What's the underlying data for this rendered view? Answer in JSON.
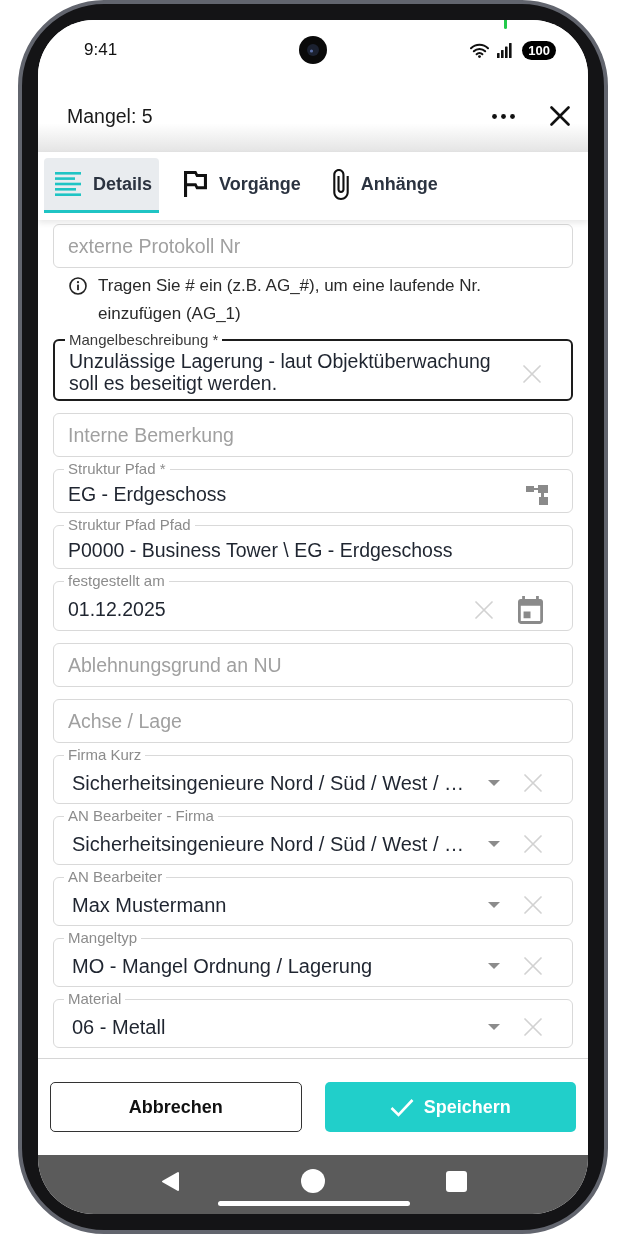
{
  "status_bar": {
    "time": "9:41",
    "battery": "100"
  },
  "header": {
    "title": "Mangel: 5"
  },
  "tabs": [
    {
      "label": "Details",
      "selected": true
    },
    {
      "label": "Vorgänge",
      "selected": false
    },
    {
      "label": "Anhänge",
      "selected": false
    }
  ],
  "form": {
    "fields": [
      {
        "kind": "text",
        "placeholder": "externe Protokoll Nr",
        "focused": false,
        "hint": "Tragen Sie # ein (z.B. AG_#), um eine laufende Nr. einzufügen (AG_1)"
      },
      {
        "kind": "multiline",
        "label": "Mangelbeschreibung *",
        "value": "Unzulässige Lagerung - laut Objektüberwachung soll es beseitigt werden.",
        "focused": true
      },
      {
        "kind": "text",
        "placeholder": "Interne Bemerkung",
        "focused": false
      },
      {
        "kind": "tree",
        "label": "Struktur Pfad *",
        "value": "EG - Erdgeschoss",
        "focused": false
      },
      {
        "kind": "text",
        "label": "Struktur Pfad Pfad",
        "value": "P0000 - Business Tower \\ EG - Erdgeschoss",
        "focused": false
      },
      {
        "kind": "date",
        "label": "festgestellt am",
        "value": "01.12.2025",
        "focused": false
      },
      {
        "kind": "text",
        "placeholder": "Ablehnungsgrund an NU",
        "focused": false
      },
      {
        "kind": "text",
        "placeholder": "Achse / Lage",
        "focused": false
      },
      {
        "kind": "select",
        "label": "Firma Kurz",
        "value": "Sicherheitsingenieure Nord / Süd / West / …",
        "focused": false
      },
      {
        "kind": "select",
        "label": "AN Bearbeiter - Firma",
        "value": "Sicherheitsingenieure Nord / Süd / West / …",
        "focused": false
      },
      {
        "kind": "select",
        "label": "AN Bearbeiter",
        "value": "Max Mustermann",
        "focused": false
      },
      {
        "kind": "select",
        "label": "Mangeltyp",
        "value": "MO - Mangel Ordnung / Lagerung",
        "focused": false
      },
      {
        "kind": "select",
        "label": "Material",
        "value": "06 - Metall",
        "focused": false
      }
    ]
  },
  "footer": {
    "buttons": [
      {
        "label": "Abbrechen",
        "kind": "secondary"
      },
      {
        "label": "Speichern",
        "kind": "primary"
      }
    ]
  }
}
